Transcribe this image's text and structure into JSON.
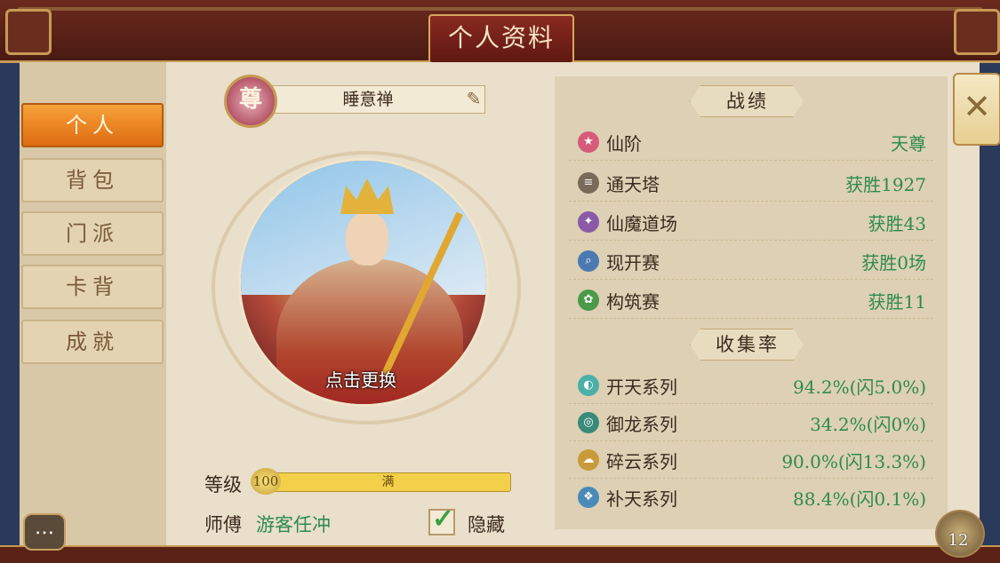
{
  "window": {
    "title": "个人资料"
  },
  "tabs": [
    {
      "label": "个人",
      "active": true
    },
    {
      "label": "背包",
      "active": false
    },
    {
      "label": "门派",
      "active": false
    },
    {
      "label": "卡背",
      "active": false
    },
    {
      "label": "成就",
      "active": false
    }
  ],
  "profile": {
    "rank_badge": "尊",
    "name": "睡意禅",
    "portrait_action": "点击更换",
    "level_label": "等级",
    "level_value": "100",
    "level_bar_text": "满",
    "level_progress": 1.0,
    "master_label": "师傅",
    "master_name": "游客任冲",
    "hide_checked": true,
    "hide_label": "隐藏"
  },
  "stats": {
    "record_header": "战绩",
    "record_rows": [
      {
        "icon": "star-icon",
        "label": "仙阶",
        "value": "天尊",
        "icon_color": "#d65a7a"
      },
      {
        "icon": "tower-icon",
        "label": "通天塔",
        "value": "获胜1927",
        "icon_color": "#7a6a5a"
      },
      {
        "icon": "demon-icon",
        "label": "仙魔道场",
        "value": "获胜43",
        "icon_color": "#8a5aa8"
      },
      {
        "icon": "search-icon",
        "label": "现开赛",
        "value": "获胜0场",
        "icon_color": "#4a7ab0"
      },
      {
        "icon": "build-icon",
        "label": "构筑赛",
        "value": "获胜11",
        "icon_color": "#4a9a4a"
      }
    ],
    "collection_header": "收集率",
    "collection_rows": [
      {
        "icon": "kaitian-icon",
        "label": "开天系列",
        "value": "94.2%(闪5.0%)",
        "icon_color": "#4ab0a8"
      },
      {
        "icon": "dragon-icon",
        "label": "御龙系列",
        "value": "34.2%(闪0%)",
        "icon_color": "#3a8a7a"
      },
      {
        "icon": "cloud-icon",
        "label": "碎云系列",
        "value": "90.0%(闪13.3%)",
        "icon_color": "#c99a3a"
      },
      {
        "icon": "sky-icon",
        "label": "补天系列",
        "value": "88.4%(闪0.1%)",
        "icon_color": "#4a8ab8"
      }
    ]
  },
  "footer": {
    "coin_count": "12"
  },
  "colors": {
    "accent": "#de6b10",
    "positive": "#2e8a50",
    "frame": "#5a2216"
  }
}
